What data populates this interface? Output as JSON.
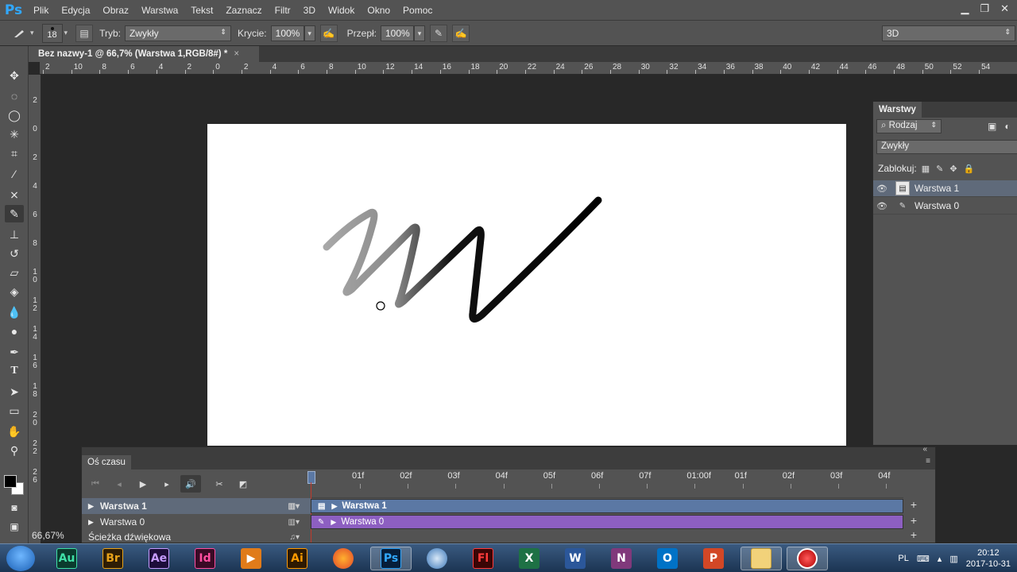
{
  "app": {
    "logo": "Ps",
    "menu": [
      "Plik",
      "Edycja",
      "Obraz",
      "Warstwa",
      "Tekst",
      "Zaznacz",
      "Filtr",
      "3D",
      "Widok",
      "Okno",
      "Pomoc"
    ],
    "window_controls": [
      "minimize-icon",
      "restore-icon",
      "close-icon"
    ]
  },
  "options": {
    "brush_size": "18",
    "mode_label": "Tryb:",
    "mode_value": "Zwykły",
    "opacity_label": "Krycie:",
    "opacity_value": "100%",
    "flow_label": "Przepł:",
    "flow_value": "100%",
    "workspace_value": "3D"
  },
  "document": {
    "tab_title": "Bez nazwy-1 @ 66,7% (Warstwa 1,RGB/8#) *",
    "tab_close": "×",
    "zoom_status": "66,67%"
  },
  "rulers": {
    "top_labels": [
      "2",
      "10",
      "8",
      "6",
      "4",
      "2",
      "0",
      "2",
      "4",
      "6",
      "8",
      "10",
      "12",
      "14",
      "16",
      "18",
      "20",
      "22",
      "24",
      "26",
      "28",
      "30",
      "32",
      "34",
      "36",
      "38",
      "40",
      "42",
      "44",
      "46",
      "48",
      "50",
      "52",
      "54"
    ],
    "left_labels": [
      "2",
      "0",
      "2",
      "4",
      "6",
      "8",
      "10",
      "12",
      "14",
      "16",
      "18",
      "20",
      "22",
      "26"
    ]
  },
  "tools": [
    "move-tool-icon",
    "marquee-tool-icon",
    "lasso-tool-icon",
    "magic-wand-tool-icon",
    "crop-tool-icon",
    "eyedropper-tool-icon",
    "healing-tool-icon",
    "brush-tool-icon",
    "stamp-tool-icon",
    "history-brush-tool-icon",
    "eraser-tool-icon",
    "bucket-tool-icon",
    "blur-tool-icon",
    "dodge-tool-icon",
    "pen-tool-icon",
    "type-tool-icon",
    "path-select-tool-icon",
    "rectangle-tool-icon",
    "hand-tool-icon",
    "zoom-tool-icon"
  ],
  "colors": {
    "foreground": "#000000",
    "background": "#ffffff",
    "accent_selected": "#5f6a7a",
    "timeline_bar_layer1": "#5b78a4",
    "timeline_bar_layer0": "#8d5fc1"
  },
  "layers_panel": {
    "tab": "Warstwy",
    "filter_label": "Rodzaj",
    "blend_mode": "Zwykły",
    "lock_label": "Zablokuj:",
    "layers": [
      {
        "name": "Warstwa 1",
        "selected": true
      },
      {
        "name": "Warstwa 0",
        "selected": false
      }
    ]
  },
  "timeline": {
    "tab": "Oś czasu",
    "ticks": [
      "01f",
      "02f",
      "03f",
      "04f",
      "05f",
      "06f",
      "07f",
      "01:00f",
      "01f",
      "02f",
      "03f",
      "04f"
    ],
    "tracks": [
      {
        "label": "Warstwa 1",
        "bar_label": "Warstwa 1",
        "selected": true
      },
      {
        "label": "Warstwa 0",
        "bar_label": "Warstwa 0",
        "selected": false
      }
    ],
    "audio_track": "Ścieżka dźwiękowa"
  },
  "taskbar": {
    "apps": [
      "Au",
      "Br",
      "Ae",
      "Id",
      "Ai",
      "Ps",
      "Fl",
      "X",
      "W",
      "N",
      "O",
      "P"
    ],
    "lang": "PL",
    "time": "20:12",
    "date": "2017-10-31"
  }
}
